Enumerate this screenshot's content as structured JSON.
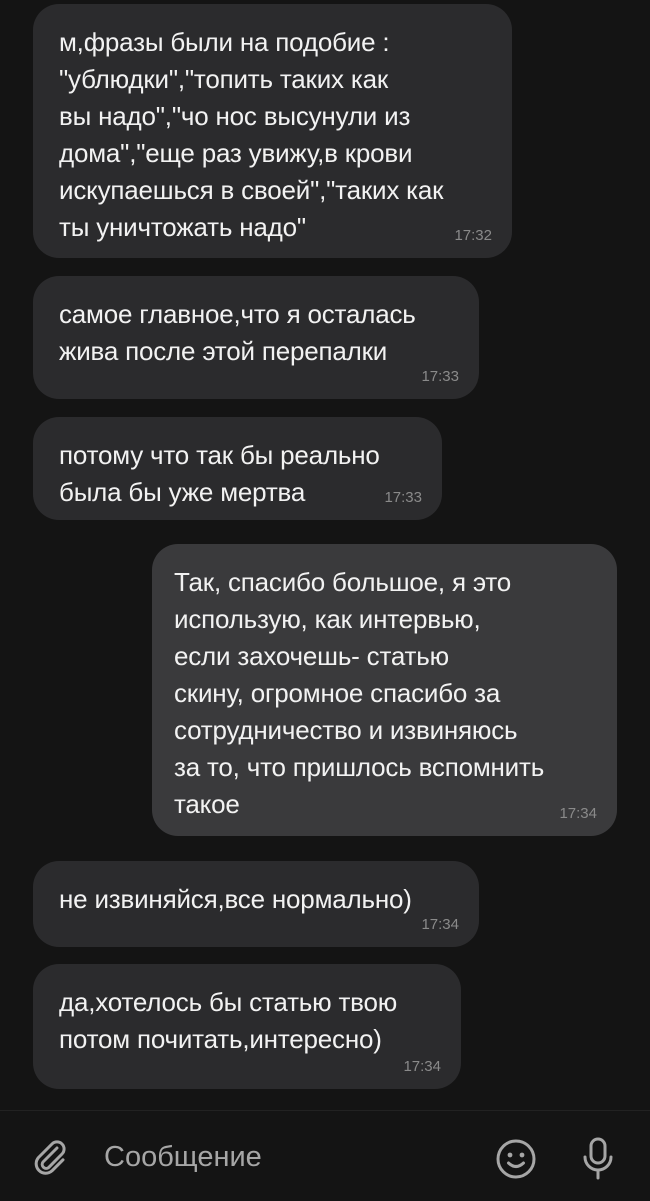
{
  "messages": [
    {
      "direction": "incoming",
      "text": "м,фразы были на подобие :\n\"ублюдки\",\"топить таких как\nвы надо\",\"чо нос высунули из\nдома\",\"еще раз увижу,в крови\nискупаешься в своей\",\"таких как\nты уничтожать надо\"",
      "time": "17:32"
    },
    {
      "direction": "incoming",
      "text": "самое главное,что я осталась\nжива после этой перепалки",
      "time": "17:33"
    },
    {
      "direction": "incoming",
      "text": "потому что так бы реально\nбыла бы уже мертва",
      "time": "17:33"
    },
    {
      "direction": "outgoing",
      "text": "Так, спасибо большое, я это\nиспользую, как интервью,\nесли захочешь- статью\nскину, огромное спасибо за\nсотрудничество и извиняюсь\nза то, что пришлось вспомнить\nтакое",
      "time": "17:34"
    },
    {
      "direction": "incoming",
      "text": "не извиняйся,все нормально)",
      "time": "17:34"
    },
    {
      "direction": "incoming",
      "text": "да,хотелось бы статью твою\nпотом почитать,интересно)",
      "time": "17:34"
    }
  ],
  "composer": {
    "placeholder": "Сообщение",
    "attach_icon": "paperclip-icon",
    "emoji_icon": "smiley-icon",
    "mic_icon": "microphone-icon"
  },
  "colors": {
    "background": "#141414",
    "incoming_bubble": "#2b2b2d",
    "outgoing_bubble": "#3a3a3c",
    "text": "#f2f2f2",
    "timestamp": "#8a8a8a",
    "icon": "#a6a6a6"
  }
}
